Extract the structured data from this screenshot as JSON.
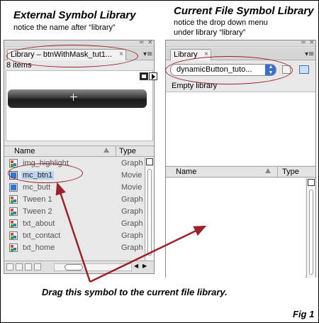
{
  "captions": {
    "external_title": "External Symbol Library",
    "external_note": "notice the name after “library”",
    "current_title": "Current File Symbol Library",
    "current_note_1": "notice the drop down menu",
    "current_note_2": "under library “library”",
    "drag_instruction": "Drag this symbol to the current file library.",
    "fig_label": "Fig 1"
  },
  "left_panel": {
    "tab_label": "Library – btnWithMask_tut1...",
    "close_glyph": "×",
    "minimize_glyph": "=",
    "item_count": "8 items",
    "columns": {
      "name": "Name",
      "type": "Type"
    },
    "items": [
      {
        "name": "img_highlight",
        "type": "Graph",
        "icon": "graphic-icon"
      },
      {
        "name": "mc_btn1",
        "type": "Movie",
        "icon": "movieclip-icon",
        "selected": true
      },
      {
        "name": "mc_butt",
        "type": "Movie",
        "icon": "movieclip-icon"
      },
      {
        "name": "Tween 1",
        "type": "Graph",
        "icon": "graphic-icon"
      },
      {
        "name": "Tween 2",
        "type": "Graph",
        "icon": "graphic-icon"
      },
      {
        "name": "txt_about",
        "type": "Graph",
        "icon": "graphic-icon"
      },
      {
        "name": "txt_contact",
        "type": "Graph",
        "icon": "graphic-icon"
      },
      {
        "name": "txt_home",
        "type": "Graph",
        "icon": "graphic-icon"
      }
    ]
  },
  "right_panel": {
    "tab_label": "Library",
    "close_glyph": "×",
    "minimize_glyph": "=",
    "dropdown_value": "dynamicButton_tuto...",
    "empty_text": "Empty library",
    "columns": {
      "name": "Name",
      "type": "Type"
    }
  },
  "colors": {
    "annotation": "#9a2228",
    "selection": "#bcd4f0",
    "dropdown_button": "#3a6fd0"
  }
}
